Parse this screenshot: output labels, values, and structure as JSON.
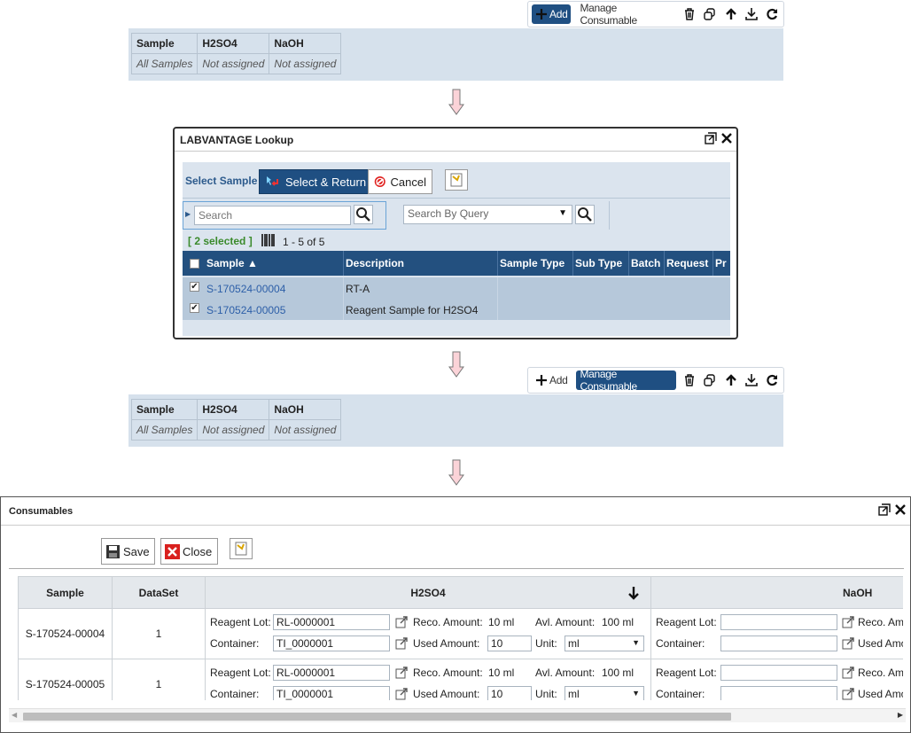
{
  "toolbar": {
    "add_label": "Add",
    "manage_label": "Manage Consumable"
  },
  "mini_table": {
    "headers": [
      "Sample",
      "H2SO4",
      "NaOH"
    ],
    "row": [
      "All Samples",
      "Not assigned",
      "Not assigned"
    ]
  },
  "lookup": {
    "title": "LABVANTAGE Lookup",
    "select_sample_label": "Select Sample",
    "select_return_label": "Select & Return",
    "cancel_label": "Cancel",
    "search_placeholder": "Search",
    "search_by_query_placeholder": "Search By Query",
    "selected_text": "[ 2 selected ]",
    "paging_text": "1 - 5 of 5",
    "columns": [
      "Sample",
      "Description",
      "Sample Type",
      "Sub Type",
      "Batch",
      "Request",
      "Pr"
    ],
    "rows": [
      {
        "sample": "S-170524-00004",
        "description": "RT-A"
      },
      {
        "sample": "S-170524-00005",
        "description": "Reagent Sample for H2SO4"
      }
    ]
  },
  "consumables": {
    "title": "Consumables",
    "save_label": "Save",
    "close_label": "Close",
    "headers": {
      "sample": "Sample",
      "dataset": "DataSet",
      "h2so4": "H2SO4",
      "naoh": "NaOH"
    },
    "labels": {
      "reagent_lot": "Reagent Lot:",
      "container": "Container:",
      "reco_amount": "Reco. Amount:",
      "used_amount": "Used Amount:",
      "avl_amount": "Avl. Amount:",
      "unit": "Unit:",
      "reco_amount_cut": "Reco. Amo",
      "used_amount_cut": "Used Amo"
    },
    "rows": [
      {
        "sample": "S-170524-00004",
        "dataset": "1",
        "reagent_lot": "RL-0000001",
        "container": "TI_0000001",
        "reco_amount": "10 ml",
        "avl_amount": "100 ml",
        "used_amount": "10",
        "unit": "ml"
      },
      {
        "sample": "S-170524-00005",
        "dataset": "1",
        "reagent_lot": "RL-0000001",
        "container": "TI_0000001",
        "reco_amount": "10 ml",
        "avl_amount": "100 ml",
        "used_amount": "10",
        "unit": "ml"
      }
    ]
  }
}
